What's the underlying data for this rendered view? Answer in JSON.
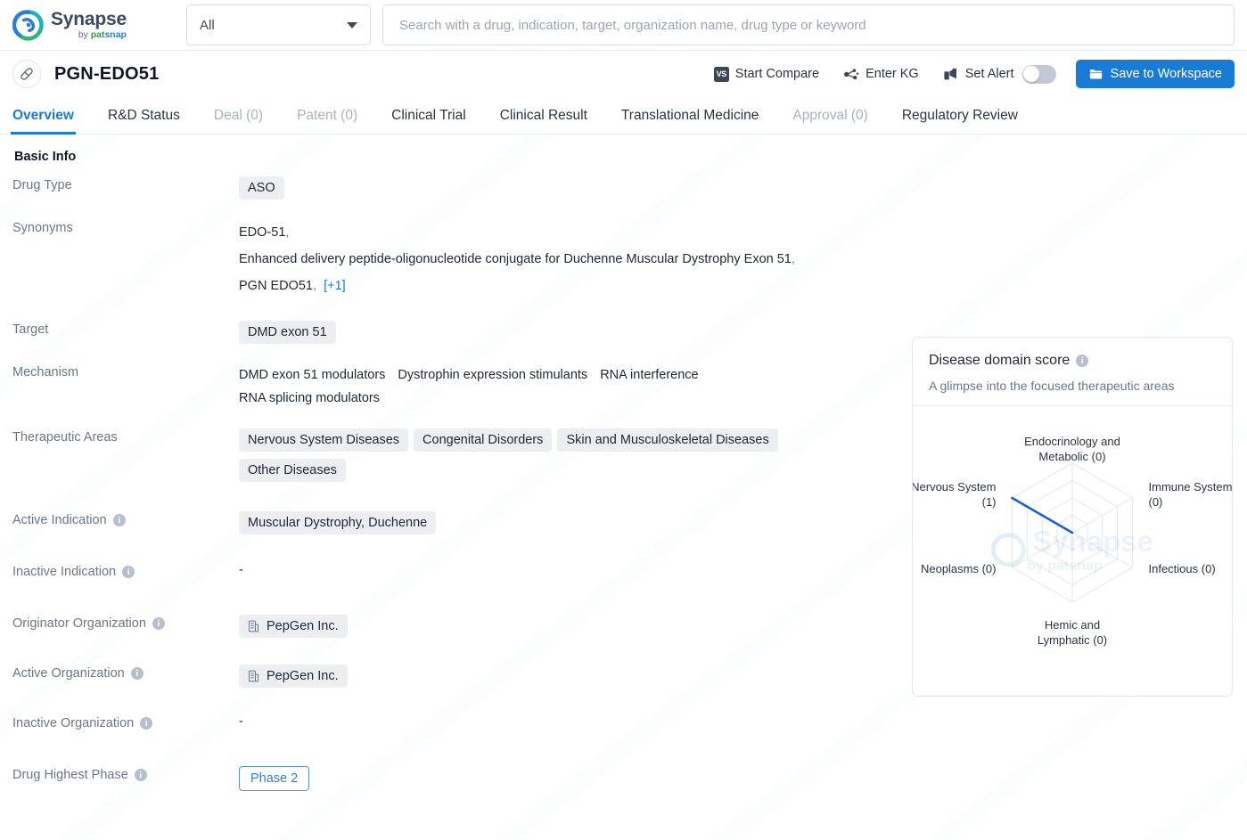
{
  "topbar": {
    "logo": {
      "name": "Synapse",
      "by": "by",
      "pat": "pat",
      "snap": "snap"
    },
    "scope": {
      "value": "All"
    },
    "search": {
      "placeholder": "Search with a drug, indication, target, organization name, drug type or keyword",
      "value": ""
    }
  },
  "drug_header": {
    "title": "PGN-EDO51",
    "actions": {
      "start_compare": "Start Compare",
      "enter_kg": "Enter KG",
      "set_alert": "Set Alert",
      "set_alert_on": false,
      "save_to_workspace": "Save to Workspace"
    }
  },
  "tabs": [
    {
      "label": "Overview",
      "state": "active"
    },
    {
      "label": "R&D Status",
      "state": "normal"
    },
    {
      "label": "Deal (0)",
      "state": "disabled"
    },
    {
      "label": "Patent (0)",
      "state": "disabled"
    },
    {
      "label": "Clinical Trial",
      "state": "normal"
    },
    {
      "label": "Clinical Result",
      "state": "normal"
    },
    {
      "label": "Translational Medicine",
      "state": "normal"
    },
    {
      "label": "Approval (0)",
      "state": "disabled"
    },
    {
      "label": "Regulatory Review",
      "state": "normal"
    }
  ],
  "basic_info": {
    "section_title": "Basic Info",
    "drug_type": {
      "label": "Drug Type",
      "values": [
        "ASO"
      ]
    },
    "synonyms": {
      "label": "Synonyms",
      "values": [
        "EDO-51",
        "Enhanced delivery peptide-oligonucleotide conjugate for Duchenne Muscular Dystrophy Exon 51",
        "PGN EDO51"
      ],
      "more": "[+1]"
    },
    "target": {
      "label": "Target",
      "values": [
        "DMD exon 51"
      ]
    },
    "mechanism": {
      "label": "Mechanism",
      "values": [
        "DMD exon 51 modulators",
        "Dystrophin expression stimulants",
        "RNA interference",
        "RNA splicing modulators"
      ]
    },
    "therapeutic_areas": {
      "label": "Therapeutic Areas",
      "values": [
        "Nervous System Diseases",
        "Congenital Disorders",
        "Skin and Musculoskeletal Diseases",
        "Other Diseases"
      ]
    },
    "active_indication": {
      "label": "Active Indication",
      "values": [
        "Muscular Dystrophy, Duchenne"
      ]
    },
    "inactive_indication": {
      "label": "Inactive Indication",
      "empty": "-"
    },
    "originator_organization": {
      "label": "Originator Organization",
      "values": [
        "PepGen Inc."
      ]
    },
    "active_organization": {
      "label": "Active Organization",
      "values": [
        "PepGen Inc."
      ]
    },
    "inactive_organization": {
      "label": "Inactive Organization",
      "empty": "-"
    },
    "drug_highest_phase": {
      "label": "Drug Highest Phase",
      "value": "Phase 2"
    }
  },
  "disease_domain_card": {
    "title": "Disease domain score",
    "subtitle": "A glimpse into the focused therapeutic areas",
    "watermark": {
      "name": "Synapse",
      "sub": "by patsnap"
    }
  },
  "chart_data": {
    "type": "radar",
    "title": "Disease domain score",
    "subtitle": "A glimpse into the focused therapeutic areas",
    "categories": [
      "Endocrinology and Metabolic (0)",
      "Immune System (0)",
      "Infectious (0)",
      "Hemic and Lymphatic (0)",
      "Neoplasms (0)",
      "Nervous System (1)"
    ],
    "short_labels": [
      "Endocrinology and Metabolic",
      "Immune System",
      "Infectious",
      "Hemic and Lymphatic",
      "Neoplasms",
      "Nervous System"
    ],
    "values": [
      0,
      0,
      0,
      0,
      0,
      1
    ],
    "rmax": 1,
    "rings": 4,
    "grid": true,
    "legend": false,
    "series_color": "#1a5fd0",
    "grid_color": "#e4e6ea"
  },
  "colors": {
    "accent": "#1a7bd4",
    "chip_bg": "#eceef2",
    "label_gray": "#6b7687",
    "disabled_tab": "#a8b1c0",
    "radar_line": "#1a5fd0"
  }
}
